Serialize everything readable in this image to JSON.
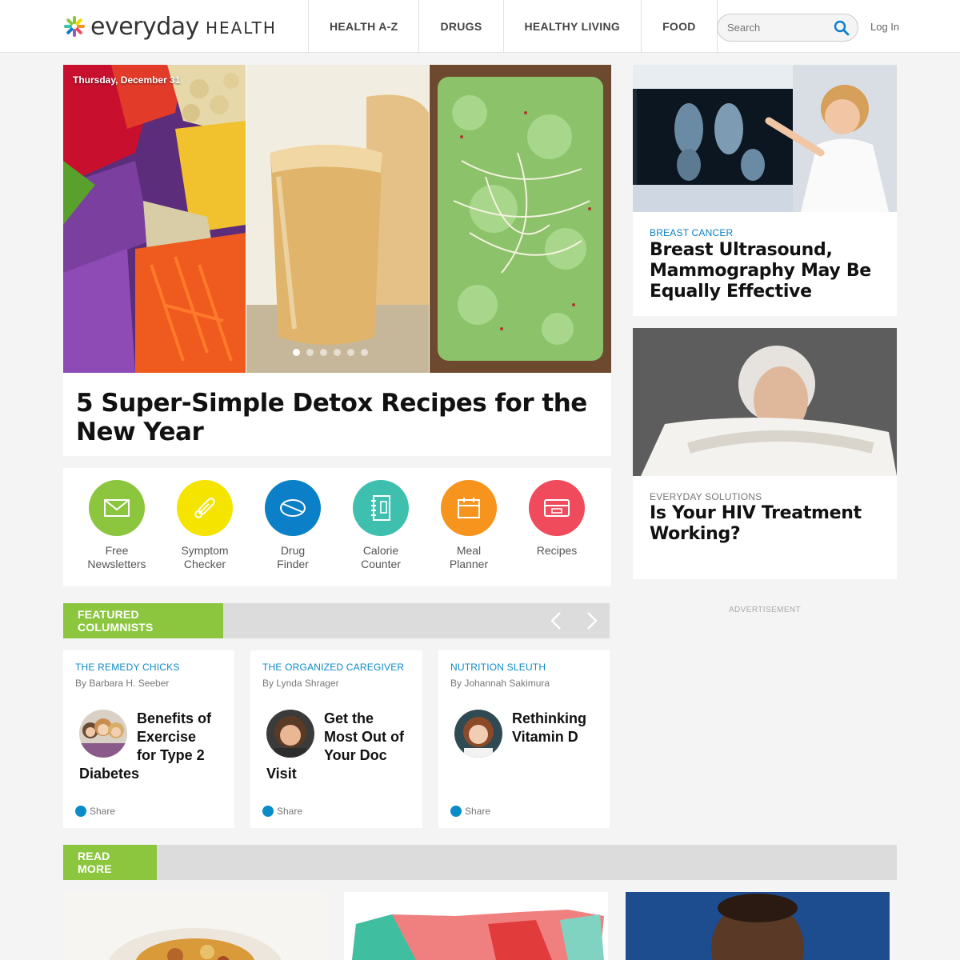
{
  "header": {
    "logo_word1": "everyday",
    "logo_word2": "HEALTH",
    "nav": [
      "HEALTH A-Z",
      "DRUGS",
      "HEALTHY LIVING",
      "FOOD"
    ],
    "search_placeholder": "Search",
    "login_label": "Log In"
  },
  "hero": {
    "date": "Thursday, December 31",
    "title": "5 Super-Simple Detox Recipes for the New Year",
    "slides_count": 6,
    "active_slide": 1
  },
  "tools": [
    {
      "label_line1": "Free",
      "label_line2": "Newsletters",
      "color": "#8cc63f",
      "icon": "envelope-icon"
    },
    {
      "label_line1": "Symptom",
      "label_line2": "Checker",
      "color": "#f5d800",
      "icon": "thermometer-icon"
    },
    {
      "label_line1": "Drug",
      "label_line2": "Finder",
      "color": "#0b7fc7",
      "icon": "pill-icon"
    },
    {
      "label_line1": "Calorie",
      "label_line2": "Counter",
      "color": "#3fbfad",
      "icon": "notebook-icon"
    },
    {
      "label_line1": "Meal",
      "label_line2": "Planner",
      "color": "#f7941d",
      "icon": "calendar-icon"
    },
    {
      "label_line1": "Recipes",
      "label_line2": "",
      "color": "#ef4b5c",
      "icon": "recipe-box-icon"
    }
  ],
  "featured": {
    "label": "FEATURED COLUMNISTS",
    "columns": [
      {
        "kicker": "THE REMEDY CHICKS",
        "author": "By Barbara H. Seeber",
        "title": "Benefits of Exercise for Type 2 Diabetes",
        "share": "Share"
      },
      {
        "kicker": "THE ORGANIZED CAREGIVER",
        "author": "By Lynda Shrager",
        "title": "Get the Most Out of Your Doc Visit",
        "share": "Share"
      },
      {
        "kicker": "NUTRITION SLEUTH",
        "author": "By Johannah Sakimura",
        "title": "Rethinking Vitamin D",
        "share": "Share"
      }
    ]
  },
  "sidebar": {
    "cards": [
      {
        "kicker": "BREAST CANCER",
        "kicker_color": "#0b7fc7",
        "title": "Breast Ultrasound, Mammography May Be Equally Effective"
      },
      {
        "kicker": "EVERYDAY SOLUTIONS",
        "kicker_color": "#777777",
        "title": "Is Your HIV Treatment Working?"
      }
    ],
    "ad_label": "ADVERTISEMENT"
  },
  "read_more": {
    "label": "READ MORE"
  },
  "colors": {
    "accent_green": "#8cc63f",
    "link_blue": "#0b8bc8"
  }
}
